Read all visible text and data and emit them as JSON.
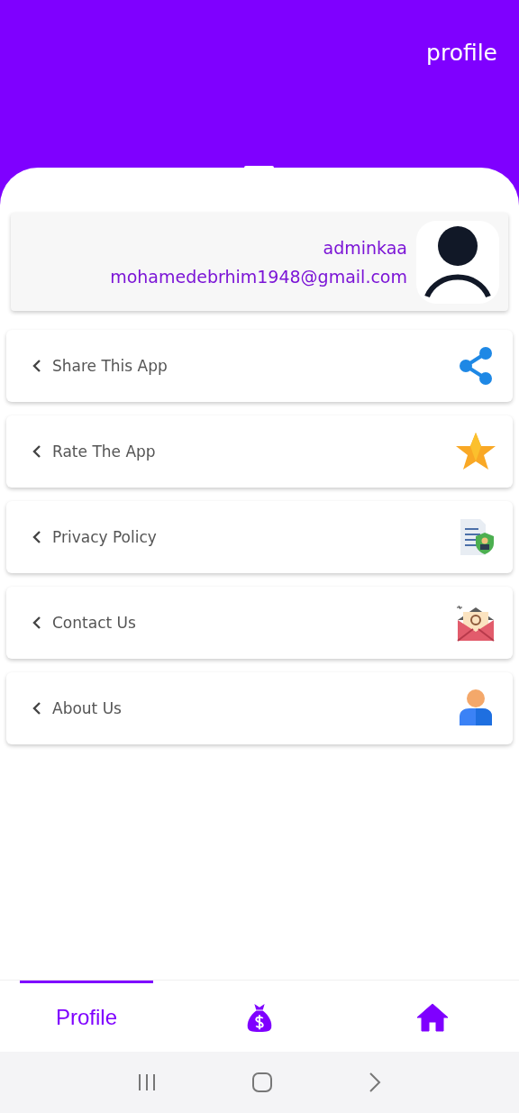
{
  "header": {
    "title": "profile"
  },
  "profile": {
    "username": "adminkaa",
    "email": "mohamedebrhim1948@gmail.com"
  },
  "menu": [
    {
      "label": "Share This App",
      "kind": "share"
    },
    {
      "label": "Rate The App",
      "kind": "star"
    },
    {
      "label": "Privacy Policy",
      "kind": "document"
    },
    {
      "label": "Contact Us",
      "kind": "mail"
    },
    {
      "label": "About Us",
      "kind": "person"
    }
  ],
  "bottom_nav": [
    {
      "kind": "text",
      "label": "Profile",
      "selected": true
    },
    {
      "kind": "money",
      "selected": false
    },
    {
      "kind": "home",
      "selected": false
    }
  ]
}
